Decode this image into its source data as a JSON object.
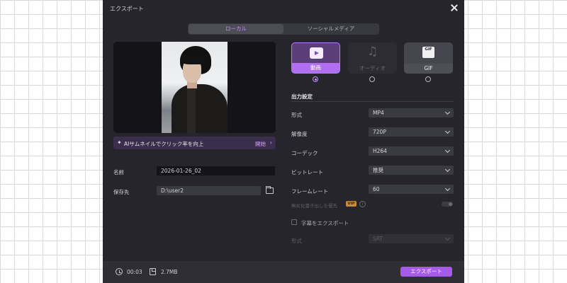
{
  "window": {
    "title": "エクスポート"
  },
  "tabs": [
    {
      "label": "ローカル",
      "active": true
    },
    {
      "label": "ソーシャルメディア",
      "active": false
    }
  ],
  "ai_banner": {
    "text": "AIサムネイルでクリック率を向上",
    "action": "開始"
  },
  "file": {
    "name_label": "名前",
    "name_value": "2026-01-26_02",
    "save_label": "保存先",
    "save_value": "D:\\user2"
  },
  "formats": [
    {
      "label": "動画",
      "icon": "video-icon",
      "selected": true
    },
    {
      "label": "オーディオ",
      "icon": "music-note-icon",
      "selected": false
    },
    {
      "label": "GIF",
      "icon": "gif-icon",
      "icon_text": "GIF",
      "selected": false
    }
  ],
  "settings": {
    "title": "出力設定",
    "rows": [
      {
        "label": "形式",
        "value": "MP4"
      },
      {
        "label": "解像度",
        "value": "720P"
      },
      {
        "label": "コーデック",
        "value": "H264"
      },
      {
        "label": "ビットレート",
        "value": "推奨"
      },
      {
        "label": "フレームレート",
        "value": "60"
      }
    ],
    "hw_label": "無劣化書き出しを優先",
    "vip_badge": "VIP",
    "subtitle_label": "字幕をエクスポート",
    "subtitle_format_label": "形式",
    "subtitle_format_value": "SRT"
  },
  "footer": {
    "duration": "00:03",
    "size": "2.7MB",
    "export_label": "エクスポート"
  },
  "colors": {
    "accent": "#a55ae8",
    "background": "#25252b",
    "selected_card": "#5a3e78"
  }
}
